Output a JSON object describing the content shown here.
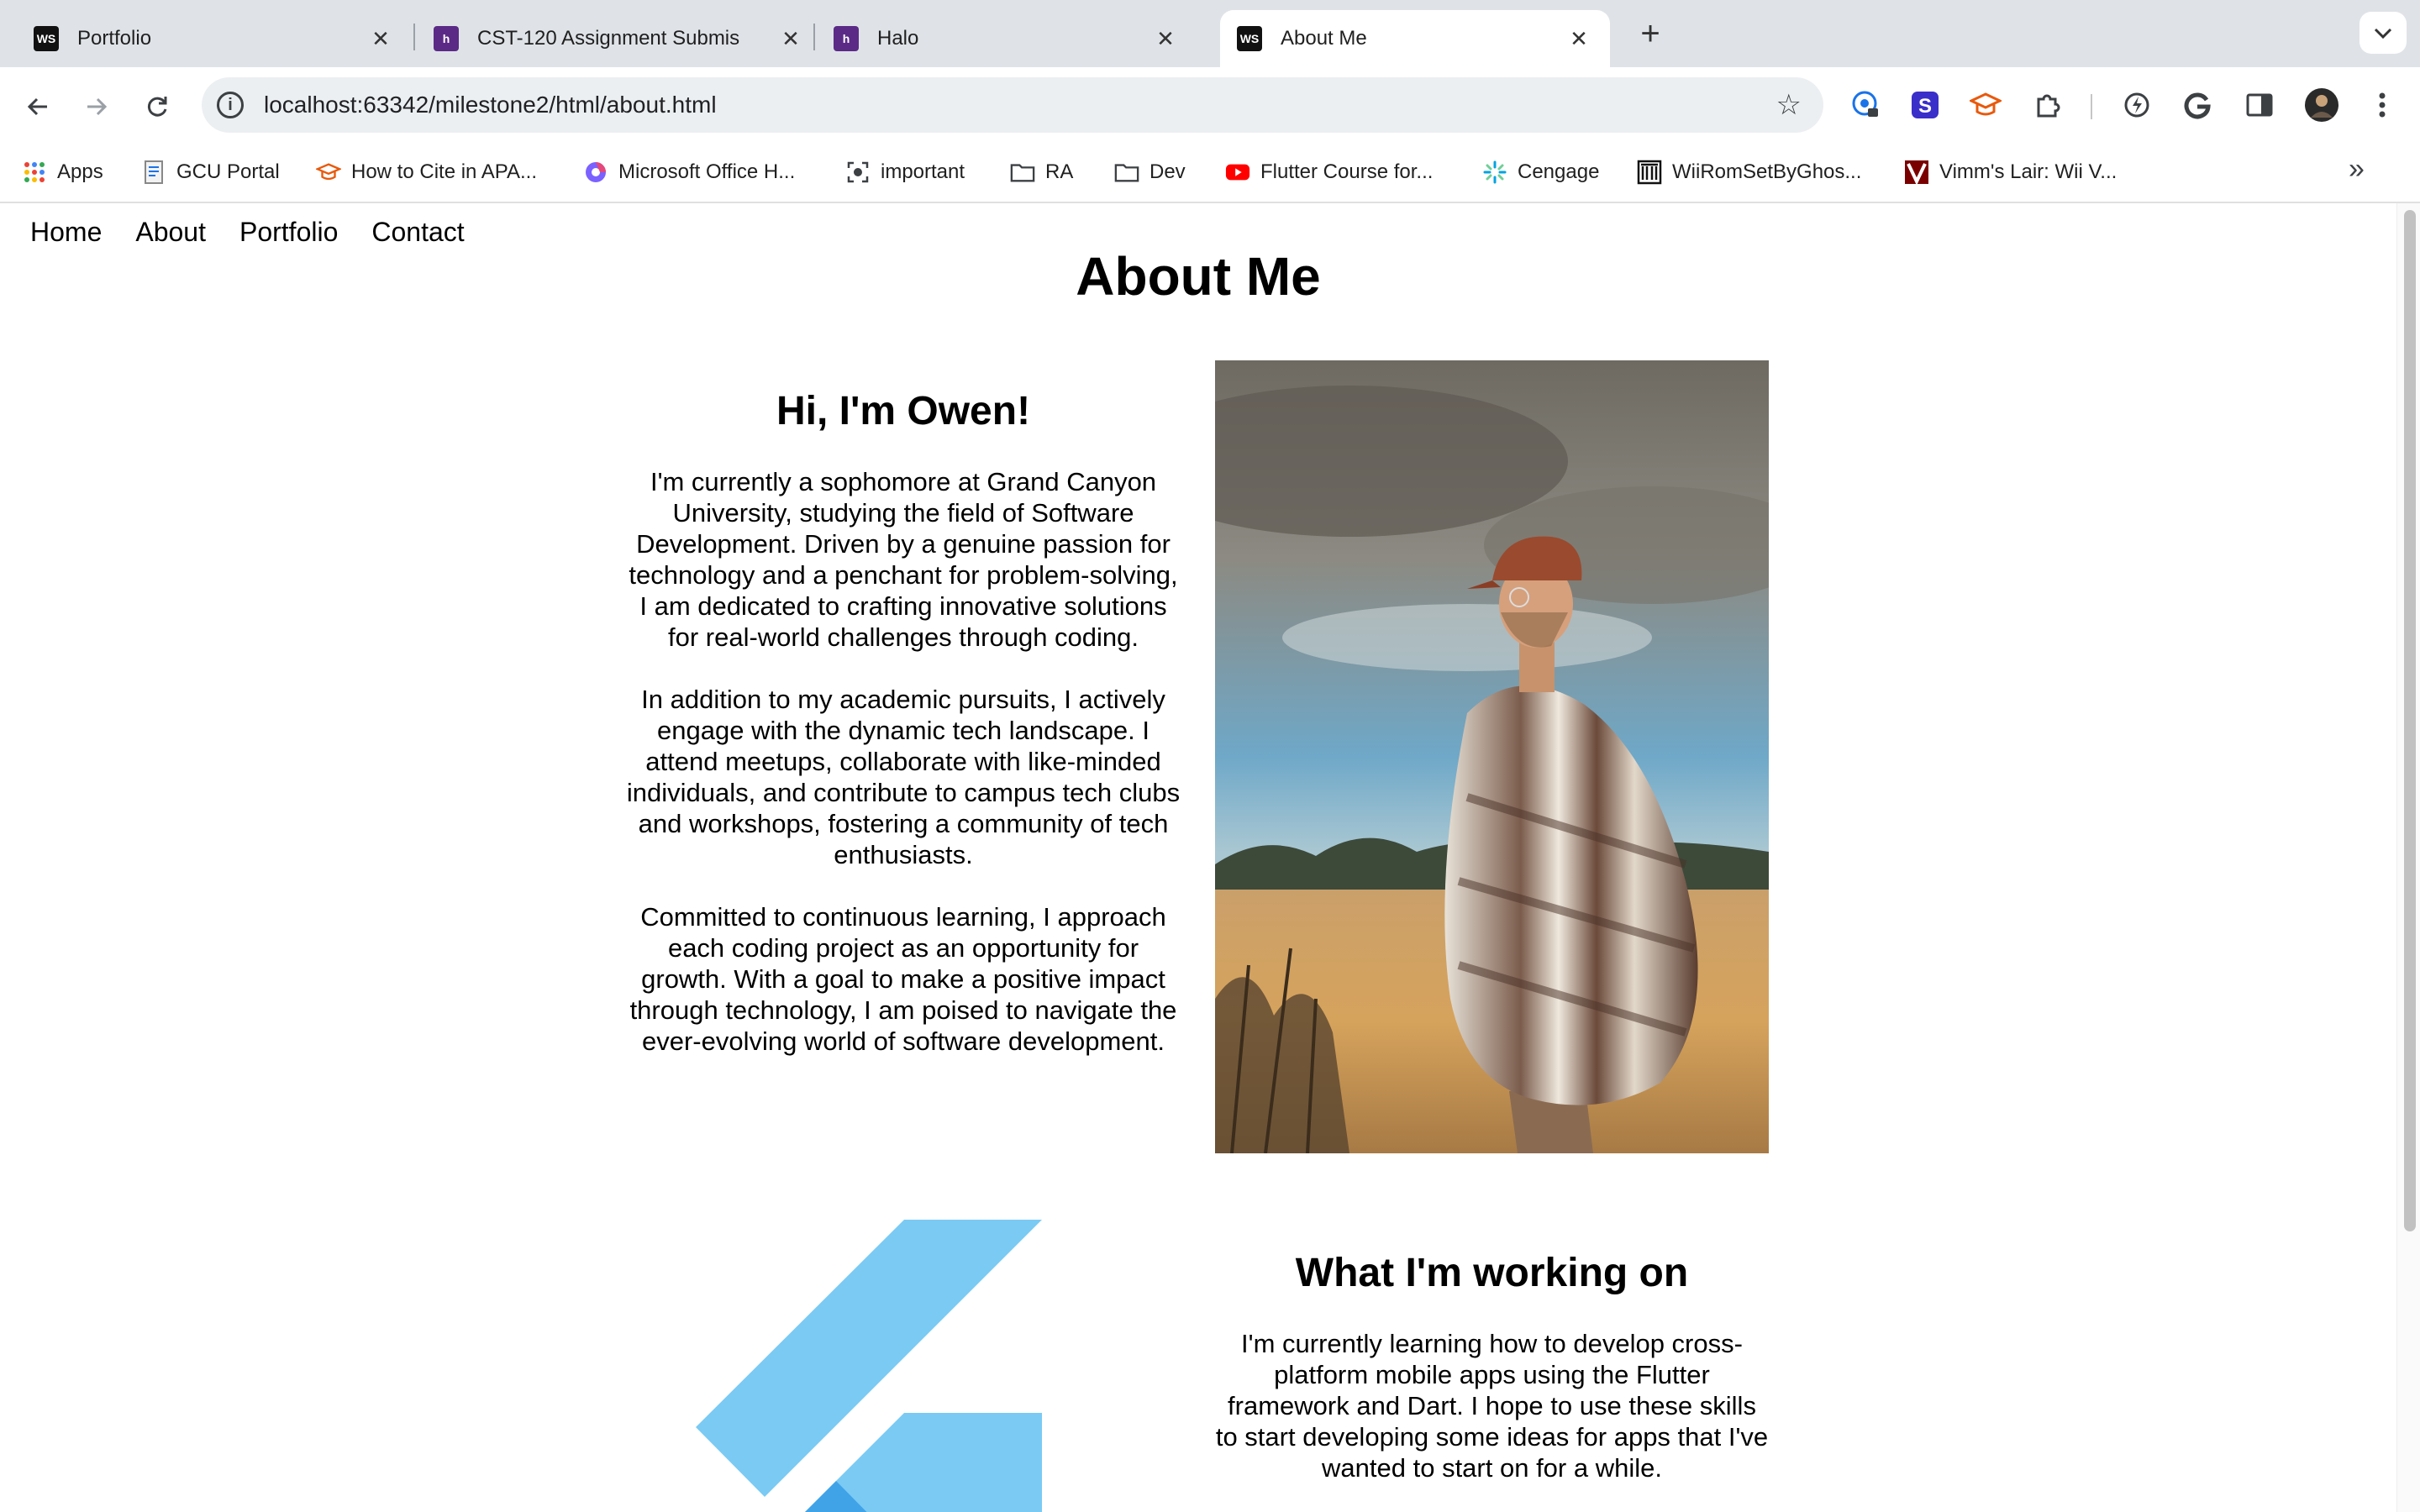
{
  "browser": {
    "tabs": [
      {
        "title": "Portfolio",
        "icon": "ws-icon"
      },
      {
        "title": "CST-120 Assignment Submis",
        "icon": "halo-icon"
      },
      {
        "title": "Halo",
        "icon": "halo-icon"
      },
      {
        "title": "About Me",
        "icon": "ws-icon",
        "active": true
      }
    ],
    "favicon_ws": "WS",
    "favicon_halo": "h",
    "new_tab": "+",
    "url": "localhost:63342/milestone2/html/about.html",
    "bookmarks": [
      {
        "label": "Apps",
        "icon": "apps-grid-icon"
      },
      {
        "label": "GCU Portal",
        "icon": "document-icon"
      },
      {
        "label": "How to Cite in APA...",
        "icon": "graduation-cap-icon"
      },
      {
        "label": "Microsoft Office H...",
        "icon": "office-icon"
      },
      {
        "label": "important",
        "icon": "capture-icon"
      },
      {
        "label": "RA",
        "icon": "folder-icon"
      },
      {
        "label": "Dev",
        "icon": "folder-icon"
      },
      {
        "label": "Flutter Course for...",
        "icon": "youtube-icon"
      },
      {
        "label": "Cengage",
        "icon": "cengage-icon"
      },
      {
        "label": "WiiRomSetByGhos...",
        "icon": "archive-icon"
      },
      {
        "label": "Vimm's Lair: Wii V...",
        "icon": "vimm-icon"
      }
    ]
  },
  "site": {
    "nav": [
      "Home",
      "About",
      "Portfolio",
      "Contact"
    ],
    "title": "About Me",
    "intro": {
      "heading": "Hi, I'm Owen!",
      "paragraphs": [
        "I'm currently a sophomore at Grand Canyon University, studying the field of Software Development. Driven by a genuine passion for technology and a penchant for problem-solving, I am dedicated to crafting innovative solutions for real-world challenges through coding.",
        "In addition to my academic pursuits, I actively engage with the dynamic tech landscape. I attend meetups, collaborate with like-minded individuals, and contribute to campus tech clubs and workshops, fostering a community of tech enthusiasts.",
        "Committed to continuous learning, I approach each coding project as an opportunity for growth. With a goal to make a positive impact through technology, I am poised to navigate the ever-evolving world of software development."
      ]
    },
    "working_on": {
      "heading": "What I'm working on",
      "paragraph": "I'm currently learning how to develop cross-platform mobile apps using the Flutter framework and Dart. I hope to use these skills to start developing some ideas for apps that I've wanted to start on for a while."
    }
  },
  "colors": {
    "tabstrip": "#dfe3e7",
    "omnibox": "#eceff1",
    "flutter_light": "#54c5f8",
    "flutter_dark": "#01579b"
  }
}
